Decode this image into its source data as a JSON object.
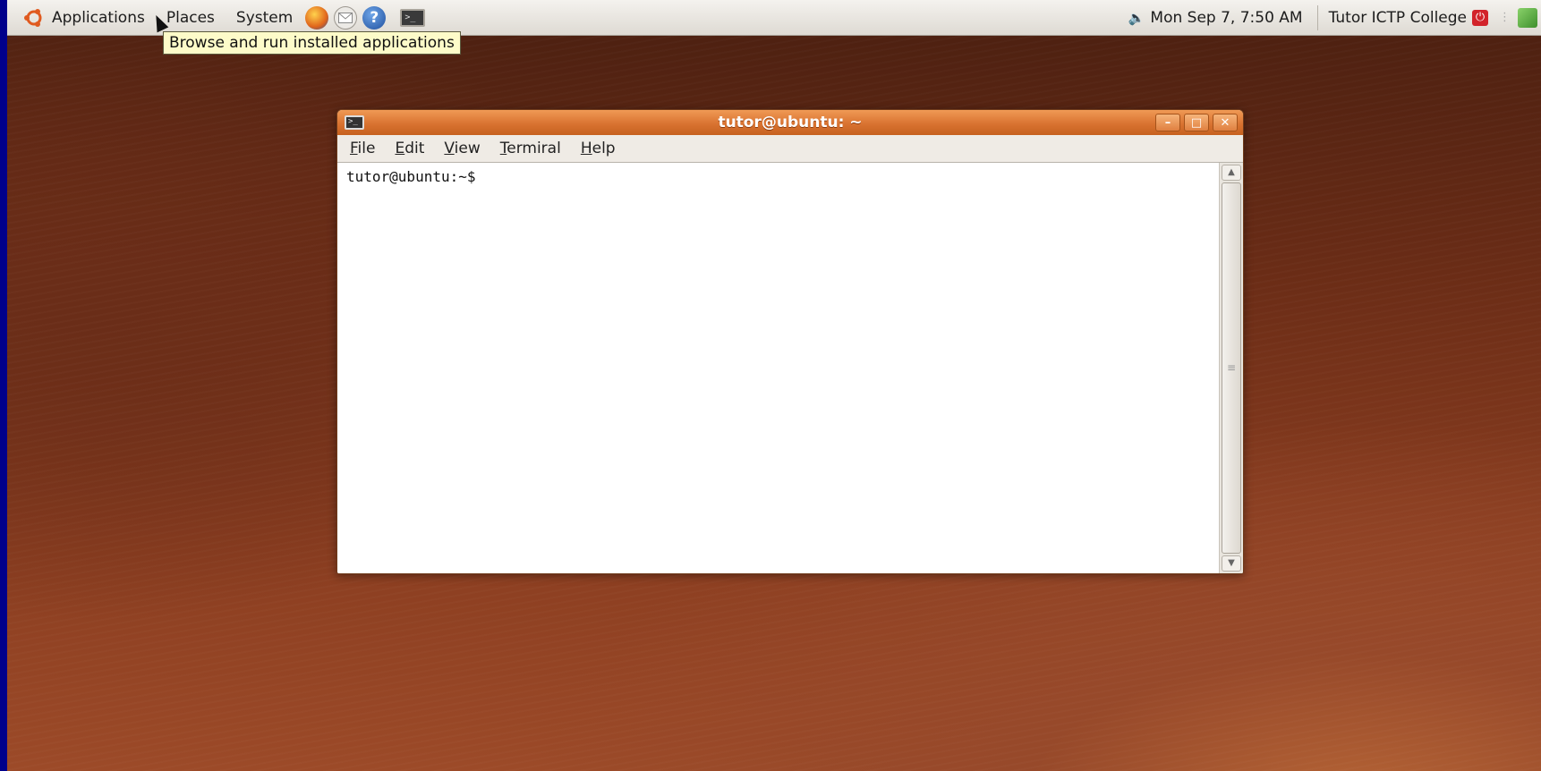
{
  "panel": {
    "menus": [
      "Applications",
      "Places",
      "System"
    ],
    "clock": "Mon Sep  7,  7:50 AM",
    "user": "Tutor ICTP College"
  },
  "tooltip": {
    "text": "Browse and run installed applications"
  },
  "window": {
    "title": "tutor@ubuntu: ~",
    "menus": [
      {
        "accel": "F",
        "rest": "ile"
      },
      {
        "accel": "E",
        "rest": "dit"
      },
      {
        "accel": "V",
        "rest": "iew"
      },
      {
        "accel": "T",
        "rest": "ermiral"
      },
      {
        "accel": "H",
        "rest": "elp"
      }
    ],
    "prompt": "tutor@ubuntu:~$"
  },
  "icons": {
    "distro": "ubuntu-logo-icon",
    "launchers": [
      "firefox-icon",
      "mail-icon",
      "help-icon",
      "terminal-icon"
    ],
    "tray": [
      "volume-icon",
      "power-icon",
      "network-icon"
    ]
  },
  "colors": {
    "titlebar": "#d97331",
    "panel": "#dedad3",
    "tooltip": "#fdfbc9",
    "desktop_border": "#00008b"
  }
}
